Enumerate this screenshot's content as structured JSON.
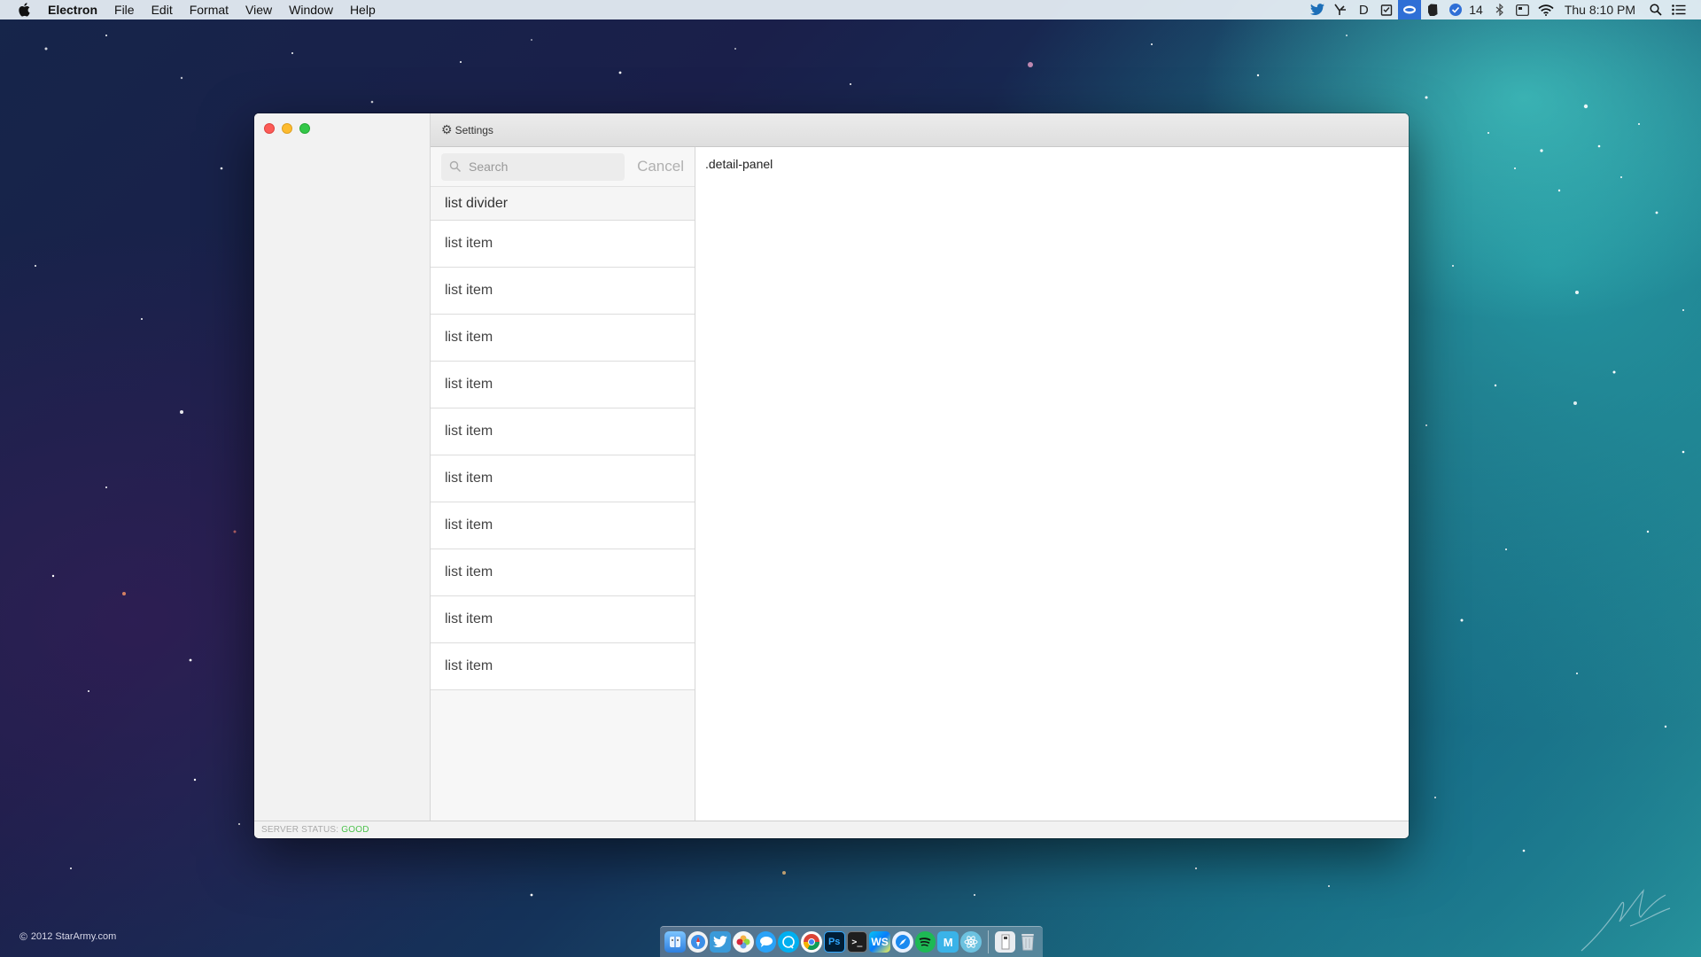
{
  "menubar": {
    "app_name": "Electron",
    "items": [
      "File",
      "Edit",
      "Format",
      "View",
      "Window",
      "Help"
    ],
    "status_count": "14",
    "clock": "Thu 8:10 PM"
  },
  "window": {
    "title": "Settings",
    "search": {
      "placeholder": "Search",
      "value": ""
    },
    "cancel_label": "Cancel",
    "divider_label": "list divider",
    "list_items": [
      "list item",
      "list item",
      "list item",
      "list item",
      "list item",
      "list item",
      "list item",
      "list item",
      "list item",
      "list item"
    ],
    "detail_text": ".detail-panel",
    "footer": {
      "label": "SERVER STATUS:",
      "value": "GOOD"
    }
  },
  "desktop": {
    "copyright": "2012 StarArmy.com"
  },
  "dock": {
    "icons": [
      "finder-icon",
      "safari-icon",
      "twitter-icon",
      "photos-icon",
      "messages-icon",
      "skype-icon",
      "chrome-icon",
      "photoshop-icon",
      "terminal-icon",
      "webstorm-icon",
      "safari-compass-icon",
      "spotify-icon",
      "mailbox-icon",
      "atom-icon",
      "documents-icon",
      "trash-icon"
    ]
  },
  "colors": {
    "status_good": "#4cc24c",
    "close": "#fc5b57",
    "minimize": "#fdbb2e",
    "maximize": "#33c748",
    "menubar_active": "#2f6fd6"
  }
}
